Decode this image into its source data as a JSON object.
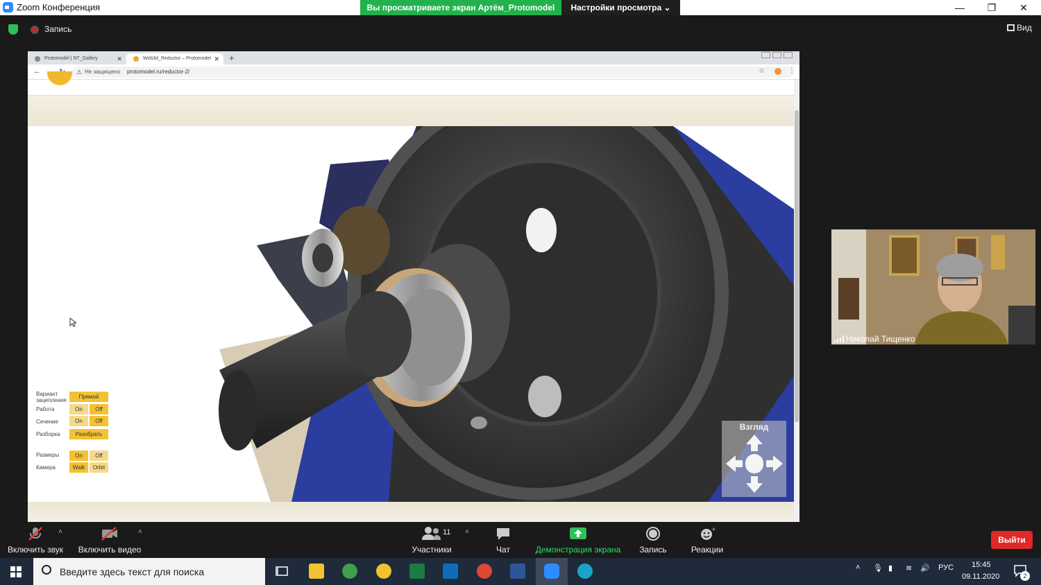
{
  "zoom": {
    "window_title": "Zoom Конференция",
    "share_banner": "Вы просматриваете экран Артём_Protomodel",
    "view_settings": "Настройки просмотра ⌄",
    "recording_label": "Запись",
    "view_label": "Вид",
    "participant_name": "Николай Тищенко",
    "participants_count": "11",
    "toolbar": {
      "mute": "Включить звук",
      "video": "Включить видео",
      "participants": "Участники",
      "chat": "Чат",
      "share": "Демонстрация экрана",
      "record": "Запись",
      "reactions": "Реакции",
      "leave": "Выйти"
    }
  },
  "browser": {
    "tabs": [
      {
        "label": "Protomodel | NT_Gallery"
      },
      {
        "label": "Web3d_Reductor – Protomodel"
      }
    ],
    "security": "Не защищено",
    "url": "protomodel.ru/reductor-2/"
  },
  "controls": {
    "engagement_label": "Вариант зацепления",
    "engagement_value": "Прямой",
    "work_label": "Работа",
    "section_label": "Сечение",
    "disassembly_label": "Разборка",
    "disassembly_value": "Разобрать",
    "dimensions_label": "Размеры",
    "camera_label": "Камера",
    "on": "On",
    "off": "Off",
    "walk": "Walk",
    "orbit": "Orbit"
  },
  "viewer": {
    "nav_label": "Взгляд"
  },
  "taskbar": {
    "search_placeholder": "Введите здесь текст для поиска",
    "lang": "РУС",
    "time": "15:45",
    "date": "09.11.2020",
    "notifications": "2"
  },
  "colors": {
    "zoom_green": "#23b14d",
    "leave_red": "#e02828",
    "button_yellow": "#f2c233",
    "gear_dark": "#3a3a3a",
    "housing_blue": "#2b3d9e"
  }
}
